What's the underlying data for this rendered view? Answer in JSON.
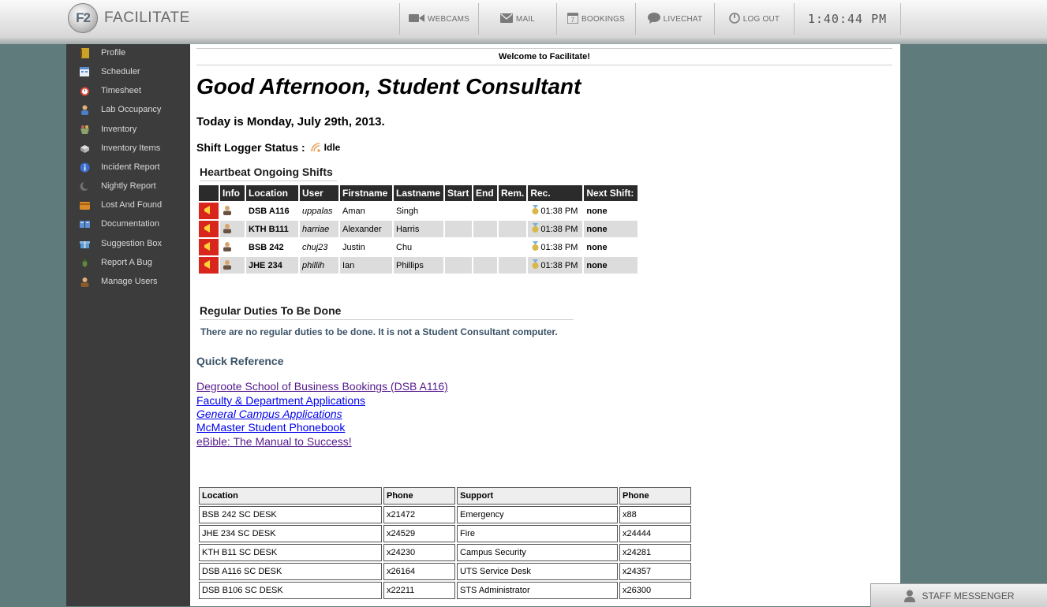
{
  "header": {
    "logo_mark": "F2",
    "app_name": "FACILITATE",
    "nav": [
      {
        "label": "WEBCAMS",
        "icon": "camera-icon"
      },
      {
        "label": "MAIL",
        "icon": "mail-icon"
      },
      {
        "label": "BOOKINGS",
        "icon": "calendar-icon"
      },
      {
        "label": "LIVECHAT",
        "icon": "chat-bubble-icon"
      },
      {
        "label": "LOG OUT",
        "icon": "power-icon"
      }
    ],
    "clock": "1:40:44 PM"
  },
  "sidebar": {
    "items": [
      {
        "label": "Profile",
        "icon": "notebook-icon"
      },
      {
        "label": "Scheduler",
        "icon": "calendar-icon"
      },
      {
        "label": "Timesheet",
        "icon": "alarm-clock-icon"
      },
      {
        "label": "Lab Occupancy",
        "icon": "person-icon"
      },
      {
        "label": "Inventory",
        "icon": "basket-icon"
      },
      {
        "label": "Inventory Items",
        "icon": "box-icon"
      },
      {
        "label": "Incident Report",
        "icon": "info-icon"
      },
      {
        "label": "Nightly Report",
        "icon": "moon-icon"
      },
      {
        "label": "Lost And Found",
        "icon": "wallet-icon"
      },
      {
        "label": "Documentation",
        "icon": "book-icon"
      },
      {
        "label": "Suggestion Box",
        "icon": "gift-icon"
      },
      {
        "label": "Report A Bug",
        "icon": "bug-icon"
      },
      {
        "label": "Manage Users",
        "icon": "users-icon"
      }
    ]
  },
  "main": {
    "welcome": "Welcome to Facilitate!",
    "greeting": "Good Afternoon, Student Consultant",
    "today": "Today is Monday, July 29th, 2013.",
    "shift_logger_label": "Shift Logger Status :",
    "shift_logger_status": "Idle",
    "heartbeat_title": "Heartbeat Ongoing Shifts",
    "heartbeat_columns": [
      "",
      "Info",
      "Location",
      "User",
      "Firstname",
      "Lastname",
      "Start",
      "End",
      "Rem.",
      "Rec.",
      "Next Shift:"
    ],
    "heartbeat_rows": [
      {
        "location": "DSB A116",
        "user": "uppalas",
        "firstname": "Aman",
        "lastname": "Singh",
        "rec": "01:38 PM",
        "next": "none"
      },
      {
        "location": "KTH B111",
        "user": "harriae",
        "firstname": "Alexander",
        "lastname": "Harris",
        "rec": "01:38 PM",
        "next": "none"
      },
      {
        "location": "BSB 242",
        "user": "chuj23",
        "firstname": "Justin",
        "lastname": "Chu",
        "rec": "01:38 PM",
        "next": "none"
      },
      {
        "location": "JHE 234",
        "user": "phillih",
        "firstname": "Ian",
        "lastname": "Phillips",
        "rec": "01:38 PM",
        "next": "none"
      }
    ],
    "duties_title": "Regular Duties To Be Done",
    "duties_message": "There are no regular duties to be done. It is not a Student Consultant computer.",
    "quick_ref_title": "Quick Reference",
    "quick_links": [
      {
        "label": "Degroote School of Business Bookings (DSB A116)",
        "color": "#551a8b",
        "italic": false
      },
      {
        "label": "Faculty & Department Applications",
        "color": "#0000ee",
        "italic": false
      },
      {
        "label": "General Campus Applications",
        "color": "#0000ee",
        "italic": true
      },
      {
        "label": "McMaster Student Phonebook",
        "color": "#0000ee",
        "italic": false
      },
      {
        "label": "eBible: The Manual to Success!",
        "color": "#551a8b",
        "italic": false
      }
    ],
    "phone_columns": [
      "Location",
      "Phone",
      "Support",
      "Phone"
    ],
    "phone_rows": [
      [
        "BSB 242 SC DESK",
        "x21472",
        "Emergency",
        "x88"
      ],
      [
        "JHE 234 SC DESK",
        "x24529",
        "Fire",
        "x24444"
      ],
      [
        "KTH B11 SC DESK",
        "x24230",
        "Campus Security",
        "x24281"
      ],
      [
        "DSB A116 SC DESK",
        "x26164",
        "UTS Service Desk",
        "x24357"
      ],
      [
        "DSB B106 SC DESK",
        "x22211",
        "STS Administrator",
        "x26300"
      ]
    ]
  },
  "messenger": {
    "label": "STAFF MESSENGER",
    "icon": "person-silhouette-icon"
  },
  "colors": {
    "sidebar_bg": "#3c3c3c",
    "page_bg": "#5f7b7c",
    "alert_red": "#d8261c",
    "accent_blue": "#3b5367"
  }
}
